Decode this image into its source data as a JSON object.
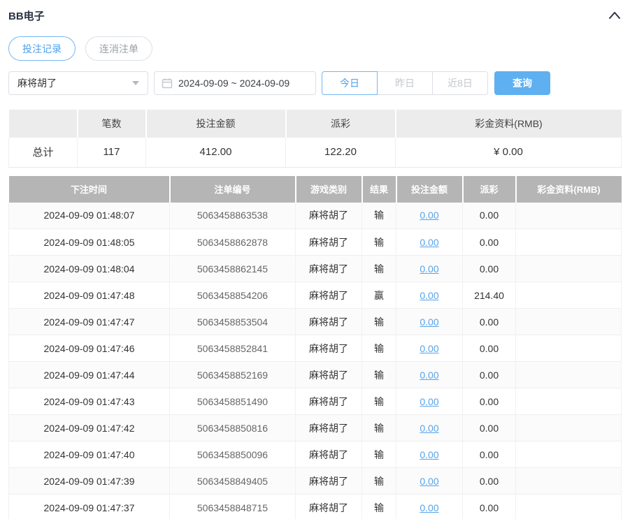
{
  "panel": {
    "title": "BB电子"
  },
  "tabs": [
    {
      "label": "投注记录",
      "active": true
    },
    {
      "label": "连消注单",
      "active": false
    }
  ],
  "filters": {
    "game_select": {
      "value": "麻将胡了"
    },
    "date_range": {
      "value": "2024-09-09 ~ 2024-09-09"
    },
    "quick_ranges": [
      {
        "label": "今日",
        "active": true
      },
      {
        "label": "昨日",
        "active": false
      },
      {
        "label": "近8日",
        "active": false
      }
    ],
    "search_label": "查询"
  },
  "summary": {
    "columns": [
      "",
      "笔数",
      "投注金额",
      "派彩",
      "彩金资料(RMB)"
    ],
    "row_label": "总计",
    "count": "117",
    "bet_amount": "412.00",
    "payout": "122.20",
    "bonus": "¥ 0.00"
  },
  "table": {
    "columns": [
      "下注时间",
      "注单编号",
      "游戏类别",
      "结果",
      "投注金额",
      "派彩",
      "彩金资料(RMB)"
    ],
    "rows": [
      {
        "time": "2024-09-09 01:48:07",
        "bet_id": "5063458863538",
        "game": "麻将胡了",
        "result": "输",
        "bet_amount": "0.00",
        "payout": "0.00",
        "bonus": ""
      },
      {
        "time": "2024-09-09 01:48:05",
        "bet_id": "5063458862878",
        "game": "麻将胡了",
        "result": "输",
        "bet_amount": "0.00",
        "payout": "0.00",
        "bonus": ""
      },
      {
        "time": "2024-09-09 01:48:04",
        "bet_id": "5063458862145",
        "game": "麻将胡了",
        "result": "输",
        "bet_amount": "0.00",
        "payout": "0.00",
        "bonus": ""
      },
      {
        "time": "2024-09-09 01:47:48",
        "bet_id": "5063458854206",
        "game": "麻将胡了",
        "result": "赢",
        "bet_amount": "0.00",
        "payout": "214.40",
        "bonus": ""
      },
      {
        "time": "2024-09-09 01:47:47",
        "bet_id": "5063458853504",
        "game": "麻将胡了",
        "result": "输",
        "bet_amount": "0.00",
        "payout": "0.00",
        "bonus": ""
      },
      {
        "time": "2024-09-09 01:47:46",
        "bet_id": "5063458852841",
        "game": "麻将胡了",
        "result": "输",
        "bet_amount": "0.00",
        "payout": "0.00",
        "bonus": ""
      },
      {
        "time": "2024-09-09 01:47:44",
        "bet_id": "5063458852169",
        "game": "麻将胡了",
        "result": "输",
        "bet_amount": "0.00",
        "payout": "0.00",
        "bonus": ""
      },
      {
        "time": "2024-09-09 01:47:43",
        "bet_id": "5063458851490",
        "game": "麻将胡了",
        "result": "输",
        "bet_amount": "0.00",
        "payout": "0.00",
        "bonus": ""
      },
      {
        "time": "2024-09-09 01:47:42",
        "bet_id": "5063458850816",
        "game": "麻将胡了",
        "result": "输",
        "bet_amount": "0.00",
        "payout": "0.00",
        "bonus": ""
      },
      {
        "time": "2024-09-09 01:47:40",
        "bet_id": "5063458850096",
        "game": "麻将胡了",
        "result": "输",
        "bet_amount": "0.00",
        "payout": "0.00",
        "bonus": ""
      },
      {
        "time": "2024-09-09 01:47:39",
        "bet_id": "5063458849405",
        "game": "麻将胡了",
        "result": "输",
        "bet_amount": "0.00",
        "payout": "0.00",
        "bonus": ""
      },
      {
        "time": "2024-09-09 01:47:37",
        "bet_id": "5063458848715",
        "game": "麻将胡了",
        "result": "输",
        "bet_amount": "0.00",
        "payout": "0.00",
        "bonus": ""
      }
    ]
  },
  "colors": {
    "accent_blue": "#5fb0f0",
    "link_blue": "#56a3e8",
    "table_header_gray": "#b5b5b5",
    "summary_header_gray": "#ececec"
  }
}
